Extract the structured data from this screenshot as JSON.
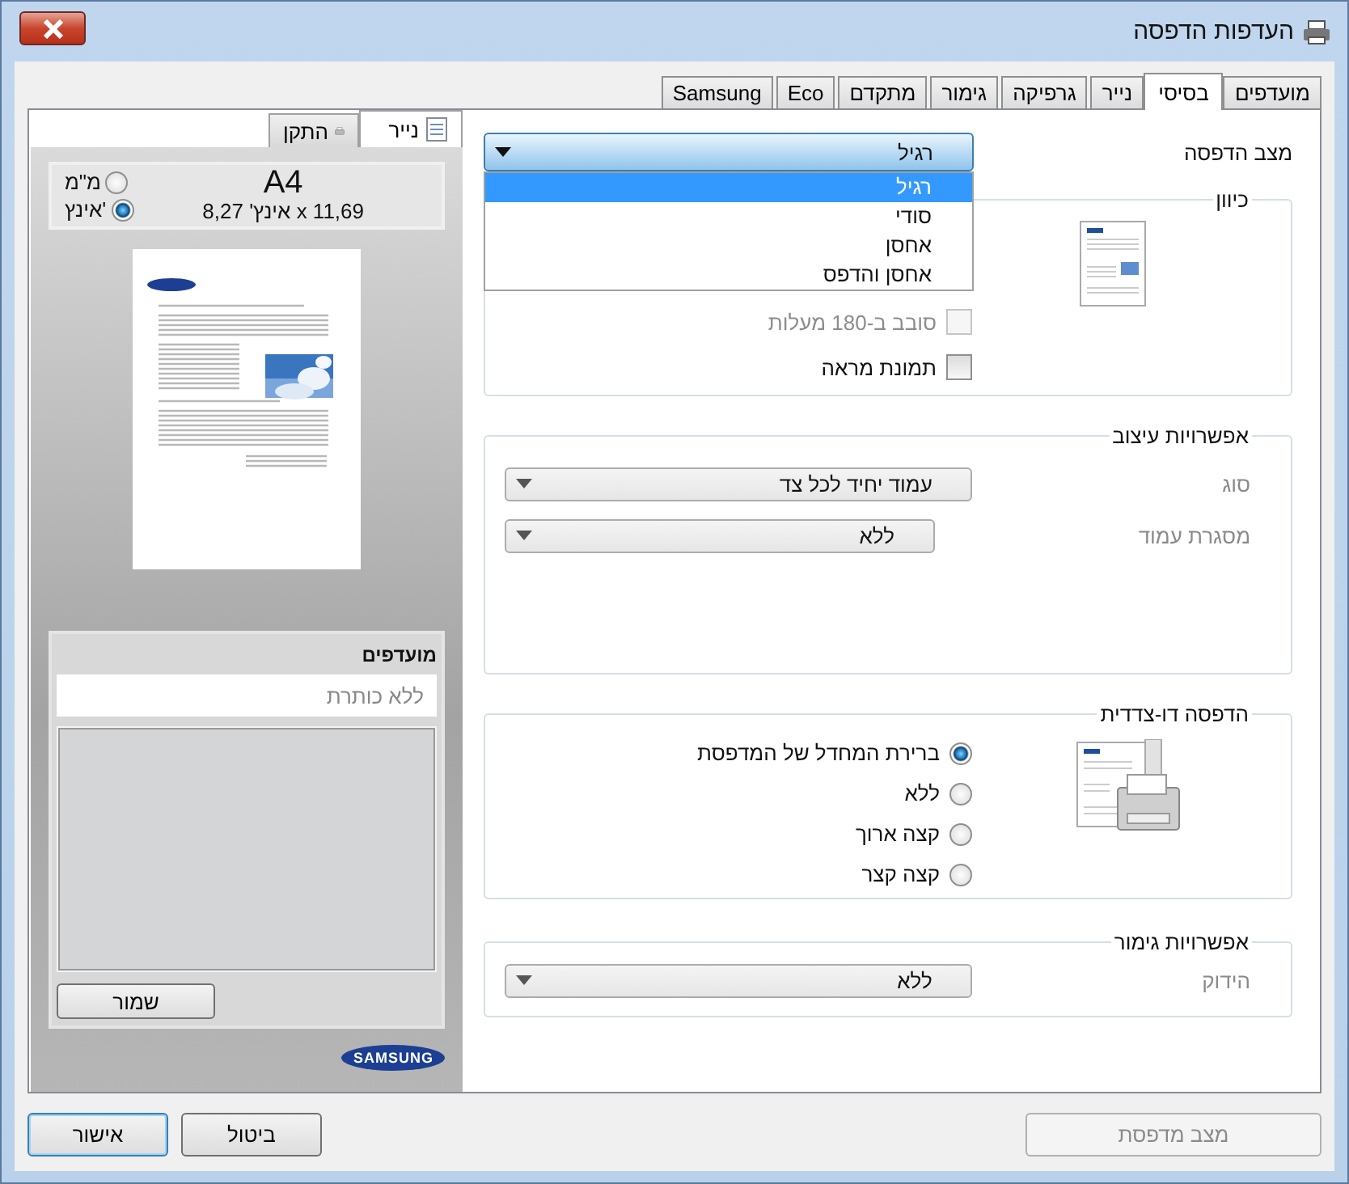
{
  "window": {
    "title": "העדפות הדפסה"
  },
  "tabs": [
    {
      "label": "מועדפים",
      "selected": false
    },
    {
      "label": "בסיסי",
      "selected": true
    },
    {
      "label": "נייר",
      "selected": false
    },
    {
      "label": "גרפיקה",
      "selected": false
    },
    {
      "label": "גימור",
      "selected": false
    },
    {
      "label": "מתקדם",
      "selected": false
    },
    {
      "label": "Eco",
      "selected": false
    },
    {
      "label": "Samsung",
      "selected": false
    }
  ],
  "preview": {
    "tabs": [
      {
        "label": "נייר",
        "selected": true,
        "kind": "paper"
      },
      {
        "label": "התקן",
        "selected": false,
        "kind": "printer"
      }
    ],
    "paper_size": {
      "name": "A4",
      "dimensions": "אינץ' 8,27 x 11,69",
      "units": [
        {
          "label": "מ\"מ",
          "selected": false
        },
        {
          "label": "אינץ'",
          "selected": true
        }
      ]
    },
    "favorites": {
      "title": "מועדפים",
      "placeholder": "ללא כותרת",
      "save": "שמור"
    },
    "logo": "SAMSUNG"
  },
  "print_mode": {
    "label": "מצב הדפסה",
    "value": "רגיל",
    "options": [
      {
        "label": "רגיל",
        "selected": true
      },
      {
        "label": "סודי",
        "selected": false
      },
      {
        "label": "אחסן",
        "selected": false
      },
      {
        "label": "אחסן והדפס",
        "selected": false
      }
    ]
  },
  "orientation": {
    "title": "כיוון",
    "options": [
      {
        "label": "סובב ב-180 מעלות",
        "checked": false,
        "disabled": true
      },
      {
        "label": "תמונת מראה",
        "checked": false,
        "disabled": false
      }
    ]
  },
  "layout": {
    "title": "אפשרויות עיצוב",
    "fields": [
      {
        "label": "סוג",
        "value": "עמוד יחיד לכל צד"
      },
      {
        "label": "מסגרת עמוד",
        "value": "ללא"
      }
    ]
  },
  "duplex": {
    "title": "הדפסה דו-צדדית",
    "options": [
      {
        "label": "ברירת המחדל של המדפסת",
        "selected": true
      },
      {
        "label": "ללא",
        "selected": false
      },
      {
        "label": "קצה ארוך",
        "selected": false
      },
      {
        "label": "קצה קצר",
        "selected": false
      }
    ]
  },
  "finishing": {
    "title": "אפשרויות גימור",
    "fields": [
      {
        "label": "הידוק",
        "value": "ללא"
      }
    ]
  },
  "buttons": {
    "printer_status": {
      "label": "מצב מדפסת",
      "disabled": true
    },
    "ok": "אישור",
    "cancel": "ביטול"
  }
}
